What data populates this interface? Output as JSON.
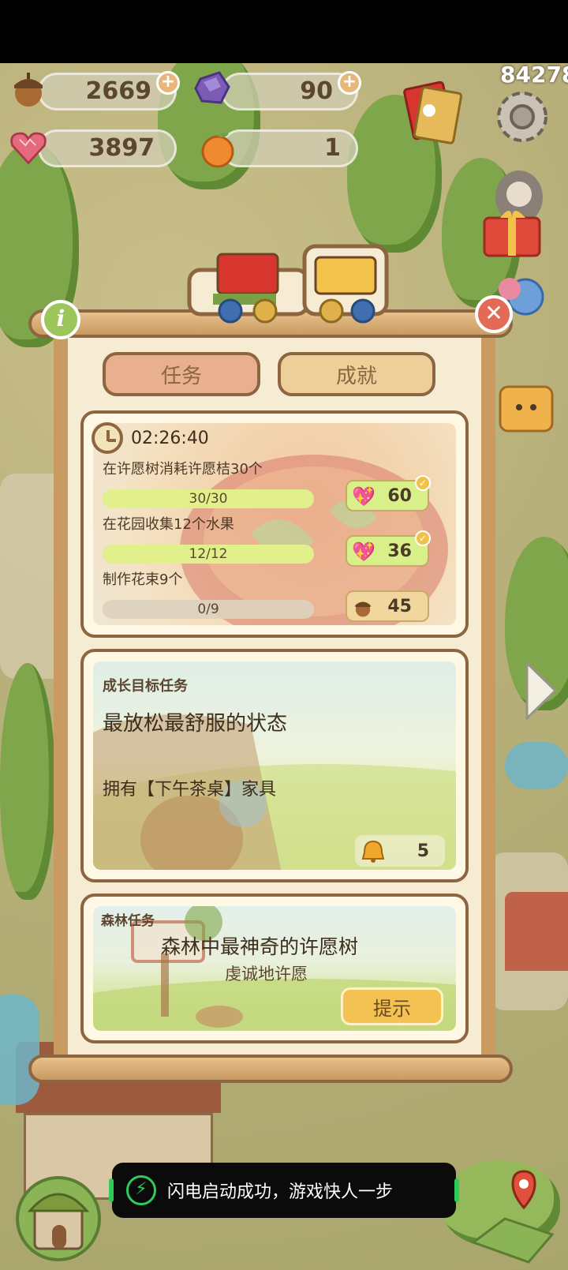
{
  "top_counter": "84278",
  "resources": {
    "acorn": {
      "value": "2669",
      "icon": "acorn-icon"
    },
    "gem": {
      "value": "90",
      "icon": "purple-gem-icon"
    },
    "heart": {
      "value": "3897",
      "icon": "heart-gem-icon"
    },
    "orange": {
      "value": "1",
      "icon": "orange-fruit-icon"
    }
  },
  "tabs": {
    "task": "任务",
    "achievement": "成就"
  },
  "daily_tasks": {
    "timer": "02:26:40",
    "items": [
      {
        "title": "在许愿树消耗许愿桔30个",
        "progress": "30/30",
        "fraction": 1.0,
        "reward": "60",
        "reward_icon": "heart-gem-icon",
        "done": true
      },
      {
        "title": "在花园收集12个水果",
        "progress": "12/12",
        "fraction": 1.0,
        "reward": "36",
        "reward_icon": "heart-gem-icon",
        "done": true
      },
      {
        "title": "制作花束9个",
        "progress": "0/9",
        "fraction": 0.0,
        "reward": "45",
        "reward_icon": "acorn-icon",
        "done": false
      }
    ]
  },
  "growth_task": {
    "header": "成长目标任务",
    "title": "最放松最舒服的状态",
    "requirement": "拥有【下午茶桌】家具",
    "reward": "5",
    "reward_icon": "bell-icon"
  },
  "forest_task": {
    "header": "森林任务",
    "title": "森林中最神奇的许愿树",
    "subtitle": "虔诚地许愿",
    "hint_button": "提示"
  },
  "toast": {
    "text": "闪电启动成功，游戏快人一步",
    "icon": "lightning-icon"
  },
  "colors": {
    "frame_brown": "#8d6541",
    "paper": "#f6ecd3",
    "progress_fill": "#e1f08b",
    "reward_green": "#d9f08a",
    "reward_tan": "#f1d79d",
    "hint_yellow": "#f3c253"
  }
}
